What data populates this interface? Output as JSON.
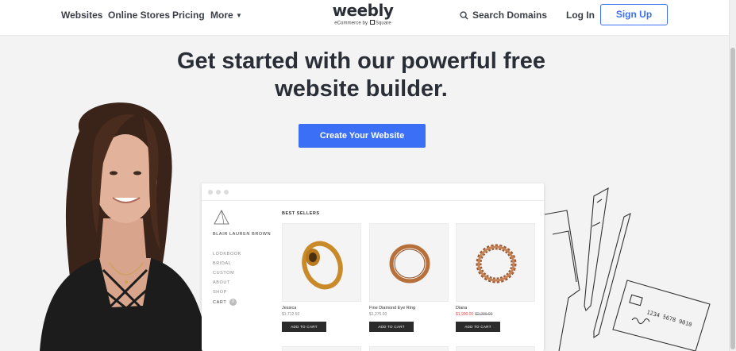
{
  "nav": {
    "websites": "Websites",
    "online_stores": "Online Stores",
    "pricing": "Pricing",
    "more": "More",
    "logo": "weebly",
    "logo_sub_a": "eCommerce by",
    "logo_sub_b": "Square",
    "search_domains": "Search Domains",
    "login": "Log In",
    "signup": "Sign Up"
  },
  "hero": {
    "headline_line1": "Get started with our powerful free",
    "headline_line2": "website builder.",
    "cta": "Create Your Website"
  },
  "colors": {
    "accent": "#3a6ff6",
    "text": "#2a2f37",
    "background": "#f3f3f3"
  },
  "mock_site": {
    "brand": "BLAIR LAUREN BROWN",
    "nav": [
      "LOOKBOOK",
      "BRIDAL",
      "CUSTOM",
      "ABOUT",
      "SHOP",
      "CART"
    ],
    "cart_count": "0",
    "section_title": "BEST SELLERS",
    "add_to_cart": "ADD TO CART",
    "products": [
      {
        "name": "Jessica",
        "price": "$1,712.50",
        "sale": false
      },
      {
        "name": "Fine Diamond Eye Ring",
        "price": "$1,275.00",
        "sale": false
      },
      {
        "name": "Diana",
        "price": "$1,900.00",
        "old_price": "$2,299.00",
        "sale": true
      }
    ]
  },
  "sketch": {
    "card_number": "1234 5678 9010"
  }
}
